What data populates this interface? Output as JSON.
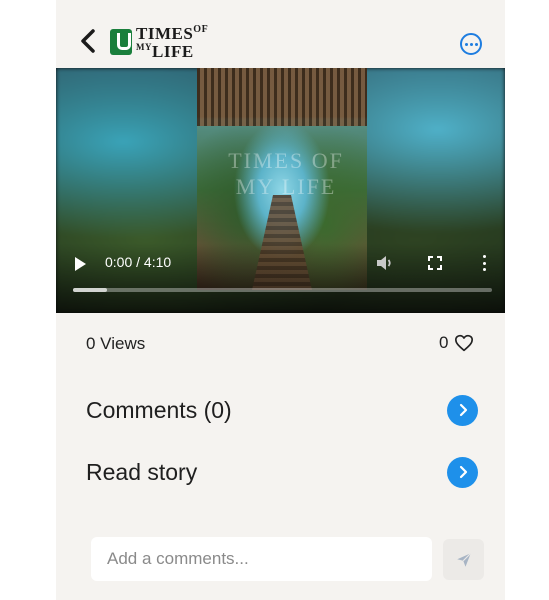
{
  "header": {
    "logo": {
      "line1": "TIMES",
      "line1_suffix": "OF",
      "line2_prefix": "MY",
      "line2": "LIFE"
    }
  },
  "video": {
    "time": "0:00 / 4:10",
    "overlay_text": "TIMES OF MY LIFE",
    "progress_buffered": 0.08
  },
  "stats": {
    "views": "0 Views",
    "likes": "0"
  },
  "actions": {
    "comments_label": "Comments (0)",
    "read_story_label": "Read story"
  },
  "comment_box": {
    "placeholder": "Add a comments..."
  },
  "colors": {
    "accent": "#1e90ea",
    "brand_green": "#1a7f3c",
    "panel_bg": "#f5f3f0"
  },
  "icons": [
    "back-arrow-icon",
    "more-options-icon",
    "play-icon",
    "volume-icon",
    "fullscreen-icon",
    "video-menu-icon",
    "heart-icon",
    "chevron-right-icon",
    "send-icon"
  ]
}
